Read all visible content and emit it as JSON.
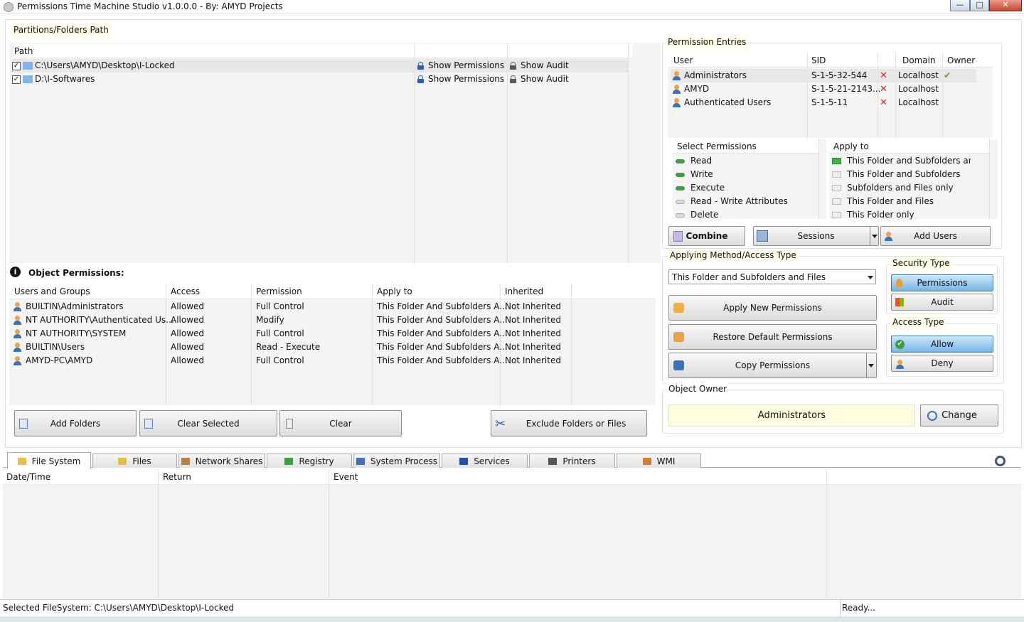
{
  "window": {
    "title": "Permissions Time Machine Studio v1.0.0.0 - By: AMYD Projects",
    "controls": {
      "minimize": "—",
      "maximize": "□",
      "close": "✕"
    }
  },
  "paths": {
    "group_label": "Partitions/Folders Path",
    "header": "Path",
    "rows": [
      {
        "path": "C:\\Users\\AMYD\\Desktop\\I-Locked",
        "show_perm": "Show Permissions",
        "show_audit": "Show Audit",
        "checked": true
      },
      {
        "path": "D:\\I-Softwares",
        "show_perm": "Show Permissions",
        "show_audit": "Show Audit",
        "checked": true
      }
    ]
  },
  "object_permissions": {
    "label": "Object Permissions:",
    "headers": [
      "Users and Groups",
      "Access",
      "Permission",
      "Apply to",
      "Inherited"
    ],
    "rows": [
      [
        "BUILTIN\\Administrators",
        "Allowed",
        "Full Control",
        "This Folder And Subfolders A...",
        "Not Inherited"
      ],
      [
        "NT AUTHORITY\\Authenticated Us...",
        "Allowed",
        "Modify",
        "This Folder And Subfolders A...",
        "Not Inherited"
      ],
      [
        "NT AUTHORITY\\SYSTEM",
        "Allowed",
        "Full Control",
        "This Folder And Subfolders A...",
        "Not Inherited"
      ],
      [
        "BUILTIN\\Users",
        "Allowed",
        "Read - Execute",
        "This Folder And Subfolders A...",
        "Not Inherited"
      ],
      [
        "AMYD-PC\\AMYD",
        "Allowed",
        "Full Control",
        "This Folder And Subfolders A...",
        "Not Inherited"
      ]
    ]
  },
  "bottom_buttons": {
    "add_folders": "Add Folders",
    "clear_selected": "Clear Selected",
    "clear": "Clear",
    "exclude": "Exclude Folders or Files"
  },
  "permission_entries": {
    "label": "Permission Entries",
    "headers": [
      "User",
      "SID",
      "",
      "Domain",
      "Owner"
    ],
    "rows": [
      {
        "user": "Administrators",
        "sid": "S-1-5-32-544",
        "x": "✕",
        "domain": "Localhost",
        "owner": "✔"
      },
      {
        "user": "AMYD",
        "sid": "S-1-5-21-2143...",
        "x": "✕",
        "domain": "Localhost",
        "owner": ""
      },
      {
        "user": "Authenticated Users",
        "sid": "S-1-5-11",
        "x": "✕",
        "domain": "Localhost",
        "owner": ""
      }
    ],
    "select_permissions": {
      "header": "Select Permissions",
      "items": [
        {
          "label": "Read",
          "on": true
        },
        {
          "label": "Write",
          "on": true
        },
        {
          "label": "Execute",
          "on": true
        },
        {
          "label": "Read - Write Attributes",
          "on": false
        },
        {
          "label": "Delete",
          "on": false
        }
      ]
    },
    "apply_to": {
      "header": "Apply to",
      "items": [
        {
          "label": "This Folder and Subfolders an...",
          "on": true
        },
        {
          "label": "This Folder and Subfolders",
          "on": false
        },
        {
          "label": "Subfolders and Files only",
          "on": false
        },
        {
          "label": "This Folder and Files",
          "on": false
        },
        {
          "label": "This Folder only",
          "on": false
        }
      ]
    },
    "buttons": {
      "combine": "Combine",
      "sessions": "Sessions",
      "add_users": "Add Users"
    }
  },
  "applying": {
    "label": "Applying Method/Access Type",
    "dropdown_value": "This Folder and Subfolders and Files",
    "apply_new": "Apply New Permissions",
    "restore": "Restore Default Permissions",
    "copy": "Copy Permissions"
  },
  "security_type": {
    "label": "Security Type",
    "permissions": "Permissions",
    "audit": "Audit"
  },
  "access_type": {
    "label": "Access Type",
    "allow": "Allow",
    "deny": "Deny"
  },
  "object_owner": {
    "label": "Object Owner",
    "value": "Administrators",
    "change": "Change"
  },
  "tabs": [
    "File System",
    "Files",
    "Network Shares",
    "Registry",
    "System Process",
    "Services",
    "Printers",
    "WMI"
  ],
  "log": {
    "headers": [
      "Date/Time",
      "Return",
      "Event"
    ]
  },
  "status": {
    "left": "Selected FileSystem: C:\\Users\\AMYD\\Desktop\\I-Locked",
    "right": "Ready..."
  },
  "colors": {
    "accent_blue": "#76b5e8",
    "label_bg": "#fffde8",
    "error_red": "#e02020"
  }
}
